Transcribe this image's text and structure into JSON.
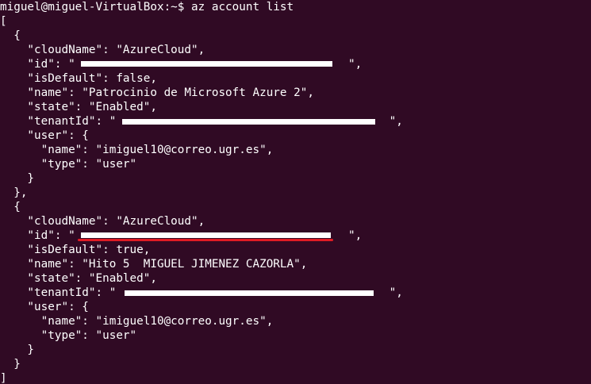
{
  "terminal": {
    "prompt": "miguel@miguel-VirtualBox:~$ az account list",
    "lines": [
      "[",
      "  {",
      "    \"cloudName\": \"AzureCloud\",",
      "    \"id\": \"                                        \",",
      "    \"isDefault\": false,",
      "    \"name\": \"Patrocinio de Microsoft Azure 2\",",
      "    \"state\": \"Enabled\",",
      "    \"tenantId\": \"                                        \",",
      "    \"user\": {",
      "      \"name\": \"imiguel10@correo.ugr.es\",",
      "      \"type\": \"user\"",
      "    }",
      "  },",
      "  {",
      "    \"cloudName\": \"AzureCloud\",",
      "    \"id\": \"                                        \",",
      "    \"isDefault\": true,",
      "    \"name\": \"Hito 5  MIGUEL JIMENEZ CAZORLA\",",
      "    \"state\": \"Enabled\",",
      "    \"tenantId\": \"                                        \",",
      "    \"user\": {",
      "      \"name\": \"imiguel10@correo.ugr.es\",",
      "      \"type\": \"user\"",
      "    }",
      "  }",
      "]"
    ]
  },
  "colors": {
    "background": "#300a24",
    "text": "#ffffff",
    "annotation": "#e01b24"
  }
}
